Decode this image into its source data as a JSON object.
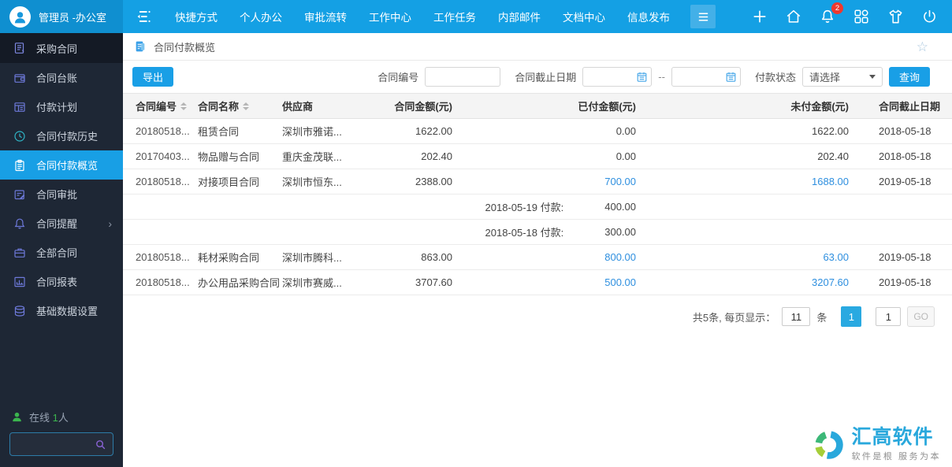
{
  "colors": {
    "accent": "#199fe6",
    "link": "#2e8fdf",
    "badge": "#f0382e",
    "online_green": "#3bb54e",
    "logo_blue": "#29a8dc",
    "logo_green": "#3cb878",
    "logo_lime": "#a6ce39"
  },
  "topbar": {
    "user": "管理员 -办公室",
    "menus": [
      "快捷方式",
      "个人办公",
      "审批流转",
      "工作中心",
      "工作任务",
      "内部邮件",
      "文档中心",
      "信息发布"
    ],
    "notification_badge": "2",
    "icons": [
      "add",
      "home",
      "notifications",
      "apps-grid",
      "tshirt",
      "power"
    ]
  },
  "sidebar": {
    "items": [
      {
        "label": "采购合同",
        "icon": "contract-doc",
        "module": true
      },
      {
        "label": "合同台账",
        "icon": "ledger"
      },
      {
        "label": "付款计划",
        "icon": "payment-plan"
      },
      {
        "label": "合同付款历史",
        "icon": "history-clock",
        "teal": true
      },
      {
        "label": "合同付款概览",
        "icon": "overview-clipboard",
        "active": true
      },
      {
        "label": "合同审批",
        "icon": "approval"
      },
      {
        "label": "合同提醒",
        "icon": "reminder-bell",
        "expandable": true
      },
      {
        "label": "全部合同",
        "icon": "all-contracts"
      },
      {
        "label": "合同报表",
        "icon": "report-chart"
      },
      {
        "label": "基础数据设置",
        "icon": "base-data"
      }
    ],
    "online": {
      "prefix": "在线",
      "count": "1",
      "suffix": "人"
    },
    "search_value": ""
  },
  "breadcrumb": {
    "title": "合同付款概览"
  },
  "toolbar": {
    "export_label": "导出",
    "contract_no_label": "合同编号",
    "contract_no_value": "",
    "deadline_label": "合同截止日期",
    "date_from_value": "",
    "range_separator": "--",
    "date_to_value": "",
    "status_label": "付款状态",
    "status_value": "请选择",
    "query_label": "查询"
  },
  "table": {
    "columns": [
      {
        "label": "合同编号",
        "sortable": true
      },
      {
        "label": "合同名称",
        "sortable": true
      },
      {
        "label": "供应商"
      },
      {
        "label": "合同金额(元)"
      },
      {
        "label": "已付金额(元)"
      },
      {
        "label": "未付金额(元)"
      },
      {
        "label": "合同截止日期"
      }
    ],
    "rows": [
      {
        "no": "20180518...",
        "name": "租赁合同",
        "supplier": "深圳市雅诺...",
        "amount": "1622.00",
        "paid": "0.00",
        "unpaid": "1622.00",
        "deadline": "2018-05-18",
        "links": false
      },
      {
        "no": "20170403...",
        "name": "物品赠与合同",
        "supplier": "重庆金茂联...",
        "amount": "202.40",
        "paid": "0.00",
        "unpaid": "202.40",
        "deadline": "2018-05-18",
        "links": false
      },
      {
        "no": "20180518...",
        "name": "对接项目合同",
        "supplier": "深圳市恒东...",
        "amount": "2388.00",
        "paid": "700.00",
        "unpaid": "1688.00",
        "deadline": "2019-05-18",
        "links": true,
        "payments": [
          {
            "label": "2018-05-19 付款:",
            "value": "400.00"
          },
          {
            "label": "2018-05-18 付款:",
            "value": "300.00"
          }
        ]
      },
      {
        "no": "20180518...",
        "name": "耗材采购合同",
        "supplier": "深圳市腾科...",
        "amount": "863.00",
        "paid": "800.00",
        "unpaid": "63.00",
        "deadline": "2019-05-18",
        "links": true
      },
      {
        "no": "20180518...",
        "name": "办公用品采购合同",
        "supplier": "深圳市赛威...",
        "amount": "3707.60",
        "paid": "500.00",
        "unpaid": "3207.60",
        "deadline": "2019-05-18",
        "links": true
      }
    ]
  },
  "pagination": {
    "total_label": "共5条, 每页显示：",
    "page_size": "11",
    "unit_label": "条",
    "current_page": "1",
    "goto_value": "1",
    "go_label": "GO"
  },
  "footer_logo": {
    "name": "汇高软件",
    "slogan": "软件是根  服务为本"
  }
}
